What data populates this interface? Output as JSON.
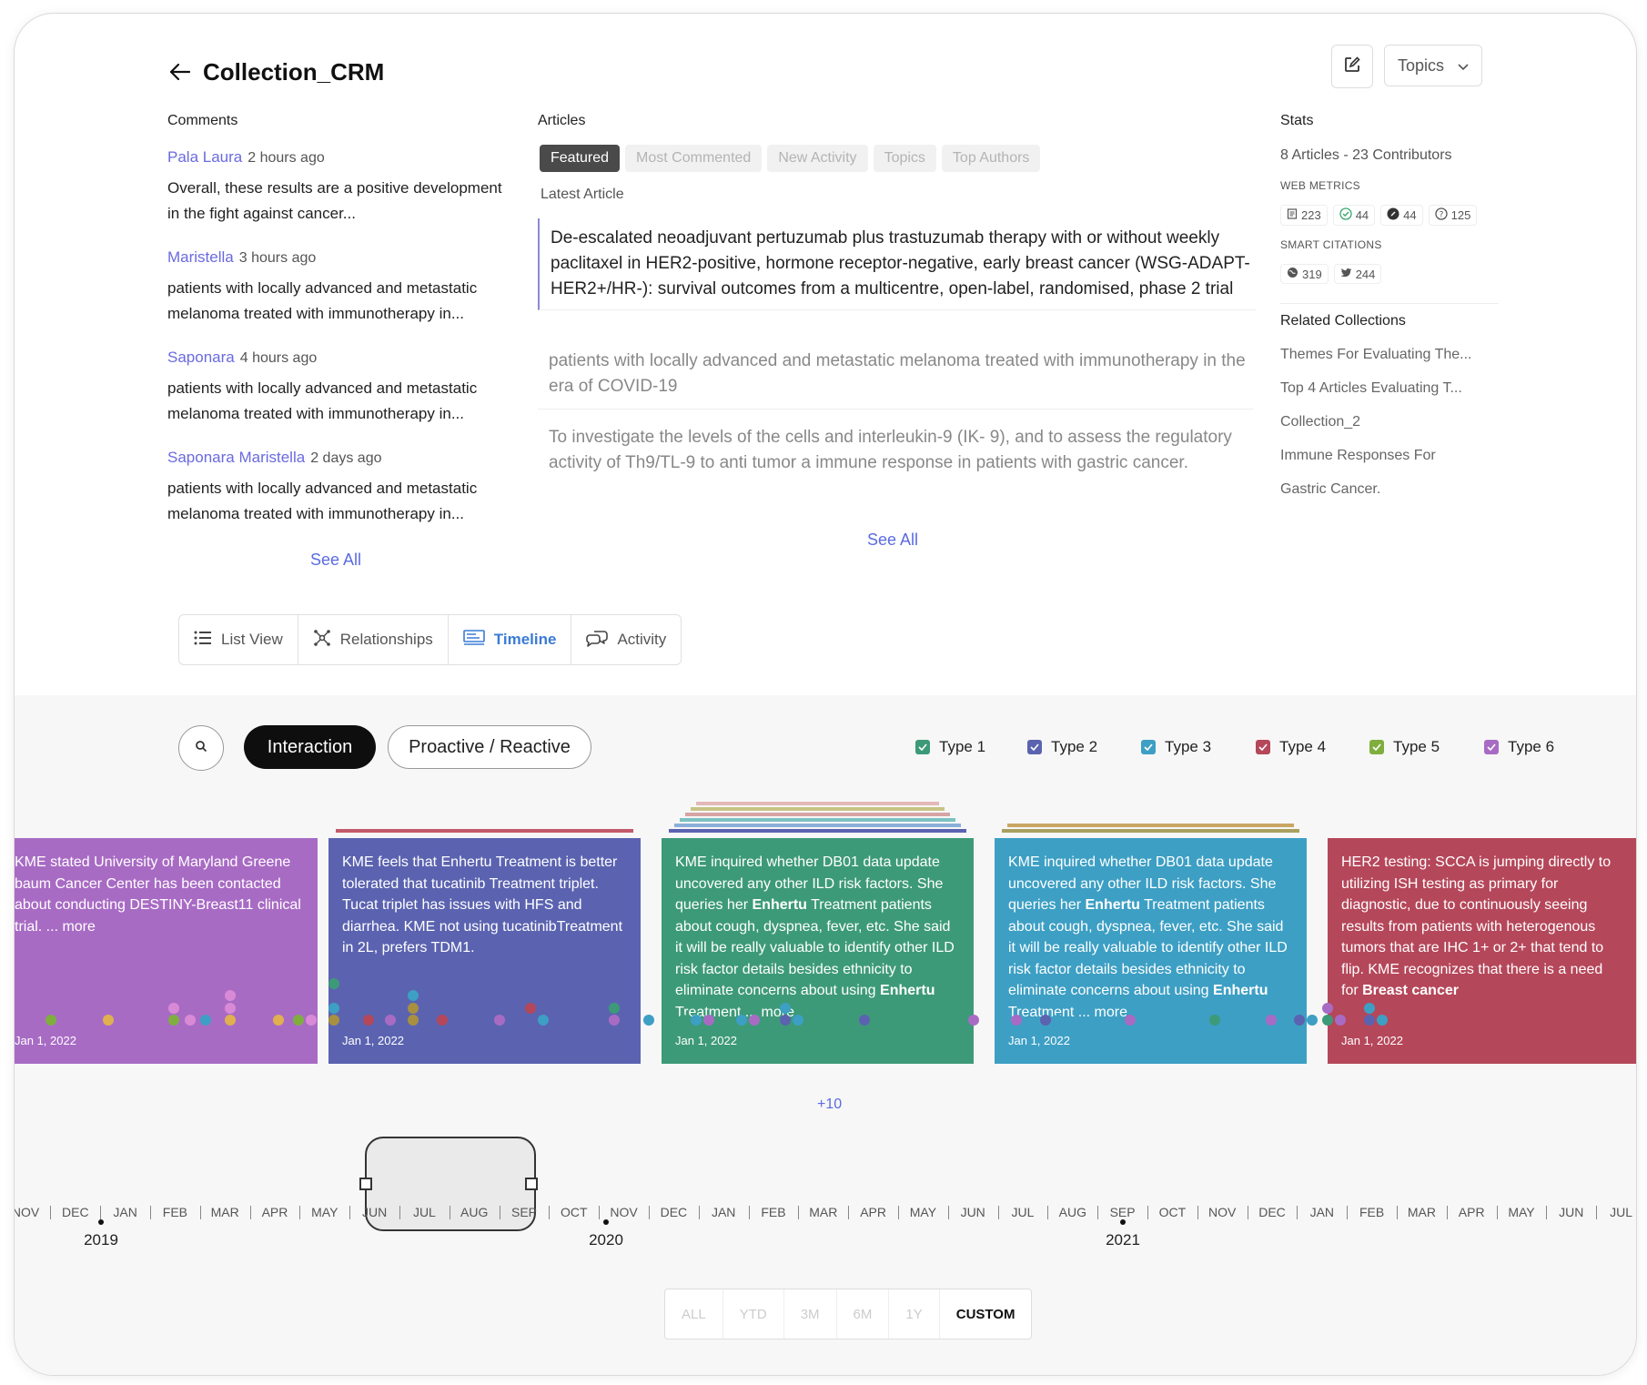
{
  "header": {
    "title": "Collection_CRM",
    "topics_label": "Topics"
  },
  "comments": {
    "label": "Comments",
    "items": [
      {
        "author": "Pala Laura",
        "time": "2 hours ago",
        "text": "Overall, these results are a positive development in the fight against cancer..."
      },
      {
        "author": "Maristella",
        "time": "3 hours ago",
        "text": "patients with locally advanced and metastatic melanoma treated with immunotherapy in..."
      },
      {
        "author": "Saponara",
        "time": "4 hours ago",
        "text": "patients with locally advanced and metastatic melanoma treated with immunotherapy in..."
      },
      {
        "author": "Saponara Maristella",
        "time": "2 days ago",
        "text": "patients with locally advanced and metastatic melanoma treated with immunotherapy in..."
      }
    ],
    "see_all": "See All"
  },
  "articles": {
    "label": "Articles",
    "filters": [
      "Featured",
      "Most Commented",
      "New Activity",
      "Topics",
      "Top Authors"
    ],
    "latest_label": "Latest Article",
    "items": [
      "De-escalated neoadjuvant pertuzumab plus trastuzumab therapy with or without weekly paclitaxel in HER2-positive, hormone receptor-negative, early breast cancer (WSG-ADAPT-HER2+/HR-): survival outcomes from a multicentre, open-label, randomised, phase 2 trial",
      "patients with locally advanced and metastatic melanoma treated with immunotherapy in the era of COVID-19",
      "To investigate the levels of the cells and interleukin-9 (IK- 9), and to assess the regulatory activity of Th9/TL-9 to  anti tumor  a immune response in patients with gastric cancer."
    ],
    "see_all": "See All"
  },
  "stats": {
    "label": "Stats",
    "summary": "8 Articles - 23 Contributors",
    "web_metrics_label": "WEB METRICS",
    "web_metrics": [
      {
        "icon": "document-icon",
        "value": "223"
      },
      {
        "icon": "check-circle-icon",
        "value": "44"
      },
      {
        "icon": "pencil-circle-icon",
        "value": "44"
      },
      {
        "icon": "question-circle-icon",
        "value": "125"
      }
    ],
    "smart_citations_label": "SMART CITATIONS",
    "smart_citations": [
      {
        "icon": "globe-icon",
        "value": "319"
      },
      {
        "icon": "twitter-icon",
        "value": "244"
      }
    ],
    "related_label": "Related Collections",
    "related": [
      "Themes For Evaluating The...",
      "Top 4 Articles Evaluating T...",
      "Collection_2",
      "Immune Responses For",
      "Gastric Cancer."
    ]
  },
  "view_tabs": [
    "List View",
    "Relationships",
    "Timeline",
    "Activity"
  ],
  "timeline": {
    "mode_buttons": [
      "Interaction",
      "Proactive / Reactive"
    ],
    "types": [
      {
        "label": "Type 1",
        "color": "#3d9a78"
      },
      {
        "label": "Type 2",
        "color": "#5b63b0"
      },
      {
        "label": "Type 3",
        "color": "#3d9fc4"
      },
      {
        "label": "Type 4",
        "color": "#b5475a"
      },
      {
        "label": "Type 5",
        "color": "#7fae3f"
      },
      {
        "label": "Type 6",
        "color": "#a86bc4"
      }
    ],
    "cards": [
      {
        "text": "KME stated University of Maryland Greene baum Cancer Center has been contacted about conducting DESTINY-Breast11 clinical trial. ... more",
        "date": "Jan 1, 2022",
        "color": "#a86bc4"
      },
      {
        "text": "KME feels that Enhertu Treatment is better tolerated that tucatinib Treatment triplet. Tucat triplet has issues with HFS and diarrhea.  KME not using tucatinibTreatment in 2L, prefers TDM1.",
        "date": "Jan 1, 2022",
        "color": "#5b63b0"
      },
      {
        "text": "KME inquired whether DB01 data update uncovered any other ILD risk factors. She queries her **Enhertu** Treatment patients about cough, dyspnea, fever, etc. She said it will be really valuable to identify other ILD risk factor details besides ethnicity to eliminate concerns about using **Enhertu** Treatment ... more",
        "date": "Jan 1, 2022",
        "color": "#3d9a78"
      },
      {
        "text": "KME inquired whether DB01 data update uncovered any other ILD risk factors. She queries her **Enhertu** Treatment patients about cough, dyspnea, fever, etc. She said it will be really valuable to identify other ILD risk factor details besides ethnicity to eliminate concerns about using **Enhertu** Treatment ... more",
        "date": "Jan 1, 2022",
        "color": "#3d9fc4"
      },
      {
        "text": "HER2 testing: SCCA is jumping directly to utilizing ISH testing as primary for diagnostic, due to continuously seeing results from patients with heterogenous tumors that are IHC 1+ or 2+ that tend to flip. KME recognizes that there is a need for **Breast cancer**",
        "date": "Jan 1, 2022",
        "color": "#b5475a"
      }
    ],
    "more_count": "+10",
    "months": [
      "NOV",
      "DEC",
      "JAN",
      "FEB",
      "MAR",
      "APR",
      "MAY",
      "JUN",
      "JUL",
      "AUG",
      "SEP",
      "OCT",
      "NOV",
      "DEC",
      "JAN",
      "FEB",
      "MAR",
      "APR",
      "MAY",
      "JUN",
      "JUL",
      "AUG",
      "SEP",
      "OCT",
      "NOV",
      "DEC",
      "JAN",
      "FEB",
      "MAR",
      "APR",
      "MAY",
      "JUN",
      "JUL"
    ],
    "years": [
      "2019",
      "2020",
      "2021"
    ],
    "ranges": [
      "ALL",
      "YTD",
      "3M",
      "6M",
      "1Y",
      "CUSTOM"
    ],
    "active_range": "CUSTOM"
  }
}
